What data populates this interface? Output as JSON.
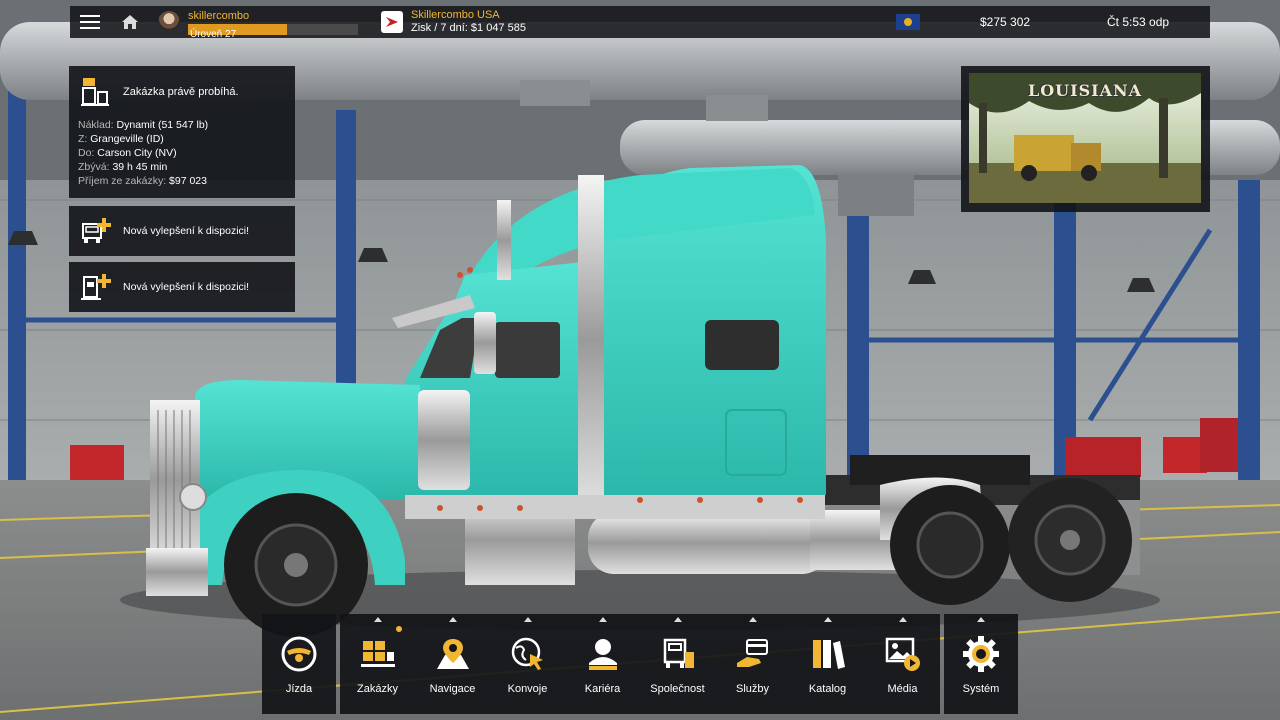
{
  "topbar": {
    "player_name": "skillercombo",
    "level_label": "Úroveň 27",
    "level_progress": 0.58,
    "company_name": "Skillercombo USA",
    "profit": "Zisk / 7 dní: $1 047 585",
    "money": "$275 302",
    "time": "Čt 5:53 odp",
    "icons": [
      "menu-icon",
      "home-icon",
      "company-logo-icon",
      "state-flag-icon"
    ]
  },
  "job": {
    "status": "Zakázka právě probíhá.",
    "cargo_label": "Náklad:",
    "cargo": "Dynamit (51 547 lb)",
    "from_label": "Z:",
    "from": "Grangeville (ID)",
    "to_label": "Do:",
    "to": "Carson City (NV)",
    "remaining_label": "Zbývá:",
    "remaining": "39 h 45 min",
    "income_label": "Příjem ze zakázky:",
    "income": "$97 023"
  },
  "notifications": [
    {
      "text": "Nová vylepšení k dispozici!",
      "icon": "truck-upgrade-icon"
    },
    {
      "text": "Nová vylepšení k dispozici!",
      "icon": "trailer-upgrade-icon"
    }
  ],
  "region": {
    "title": "LOUISIANA"
  },
  "menu": {
    "drive": "Jízda",
    "jobs": "Zakázky",
    "navigation": "Navigace",
    "convoys": "Konvoje",
    "career": "Kariéra",
    "company": "Společnost",
    "services": "Služby",
    "catalog": "Katalog",
    "media": "Média",
    "system": "Systém"
  },
  "colors": {
    "accent": "#f2b632",
    "level_bar": "#e09a20",
    "truck": "#3fd6c6",
    "panel": "#141619"
  }
}
